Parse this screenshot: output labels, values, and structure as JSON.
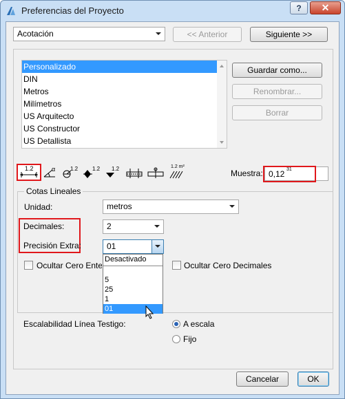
{
  "window": {
    "title": "Preferencias del Proyecto"
  },
  "colors": {
    "accent": "#3399ff",
    "highlight": "#e0171b",
    "titlebar": "#c9dff5",
    "close": "#c9452d"
  },
  "header": {
    "category_value": "Acotación",
    "prev_label": "<< Anterior",
    "next_label": "Siguiente >>"
  },
  "presets": {
    "items": [
      "Personalizado",
      "DIN",
      "Metros",
      "Milímetros",
      "US Arquitecto",
      "US Constructor",
      "US Detallista"
    ],
    "selected_index": 0,
    "save_label": "Guardar como...",
    "rename_label": "Renombrar...",
    "delete_label": "Borrar"
  },
  "toolbar": {
    "icons": [
      "linear-dimension-icon",
      "angular-dimension-icon",
      "radial-dimension-icon",
      "level-dimension-icon",
      "elevation-dimension-icon",
      "door-window-dimension-icon",
      "sill-height-dimension-icon",
      "area-dimension-icon"
    ],
    "icon_texts": [
      "1.2",
      "α",
      "1.2",
      "1.2",
      "1.2",
      "",
      "",
      "1.2 m²"
    ],
    "sample_label": "Muestra:",
    "sample_value": "0,12",
    "sample_sup": "31"
  },
  "linear": {
    "group_title": "Cotas Lineales",
    "unit_label": "Unidad:",
    "unit_value": "metros",
    "decimals_label": "Decimales:",
    "decimals_value": "2",
    "precision_label": "Precisión Extra:",
    "precision_value": "01",
    "precision_options": [
      "Desactivado",
      "5",
      "25",
      "1",
      "01"
    ],
    "precision_selected_index": 4,
    "zero_int_label": "Ocultar Cero Entero",
    "zero_dec_label": "Ocultar Cero Decimales"
  },
  "witness": {
    "label": "Escalabilidad Línea Testigo:",
    "scale_label": "A escala",
    "fixed_label": "Fijo"
  },
  "footer": {
    "cancel_label": "Cancelar",
    "ok_label": "OK"
  }
}
